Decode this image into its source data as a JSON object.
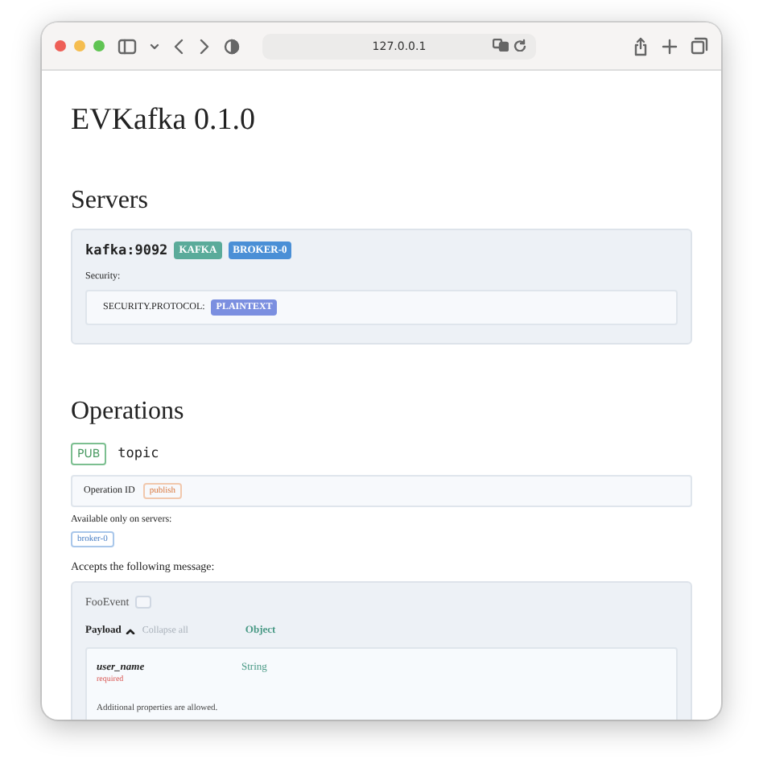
{
  "browser": {
    "url": "127.0.0.1"
  },
  "title": "EVKafka 0.1.0",
  "servers_heading": "Servers",
  "servers": [
    {
      "host": "kafka:9092",
      "tags": [
        {
          "label": "KAFKA",
          "kind": "protocol"
        },
        {
          "label": "BROKER-0",
          "kind": "name"
        }
      ],
      "security_label": "Security:",
      "security": [
        {
          "key": "SECURITY.PROTOCOL:",
          "value": "PLAINTEXT"
        }
      ]
    }
  ],
  "operations_heading": "Operations",
  "operations": [
    {
      "action": "PUB",
      "channel": "topic",
      "operation_id_label": "Operation ID",
      "operation_id": "publish",
      "servers_label": "Available only on servers:",
      "servers": [
        "broker-0"
      ],
      "message_label": "Accepts the following message:",
      "message": {
        "name": "FooEvent",
        "payload_label": "Payload",
        "expanded": true,
        "collapse_label": "Collapse all",
        "payload_type": "Object",
        "properties": [
          {
            "name": "user_name",
            "type": "String",
            "required": true,
            "required_label": "required"
          }
        ],
        "additional": "Additional properties are allowed."
      }
    }
  ]
}
